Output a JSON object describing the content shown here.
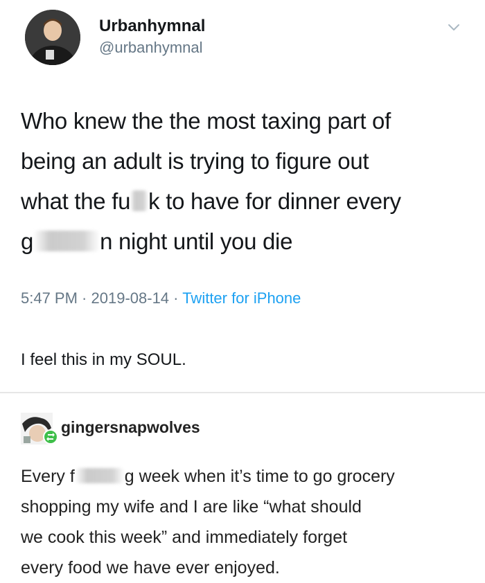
{
  "tweet": {
    "display_name": "Urbanhymnal",
    "handle": "@urbanhymnal",
    "text_line1": "Who knew the the most taxing part of",
    "text_line2": "being an adult is trying to figure out",
    "text_line3_a": "what the fu",
    "text_line3_b": "k to have for dinner every",
    "text_line4_a": "g",
    "text_line4_b": "n night until you die",
    "time": "5:47 PM",
    "date": "2019-08-14",
    "source": "Twitter for iPhone",
    "separator": " · ",
    "avatar_icon": "user-avatar-photo",
    "menu_icon": "chevron-down-icon"
  },
  "caption": "I feel this in my SOUL.",
  "reply": {
    "username": "gingersnapwolves",
    "avatar_icon": "user-avatar-photo",
    "badge_icon": "reblog-icon",
    "badge_color": "#3fbf4a",
    "text_line1_a": "Every f",
    "text_line1_b": "g week when it’s time to go grocery",
    "text_line2": "shopping my wife and I are like “what should",
    "text_line3": "we cook this week” and immediately forget",
    "text_line4": "every food we have ever enjoyed."
  },
  "colors": {
    "text": "#14171a",
    "muted": "#657786",
    "link": "#1da1f2",
    "divider": "#e6e6e6"
  }
}
